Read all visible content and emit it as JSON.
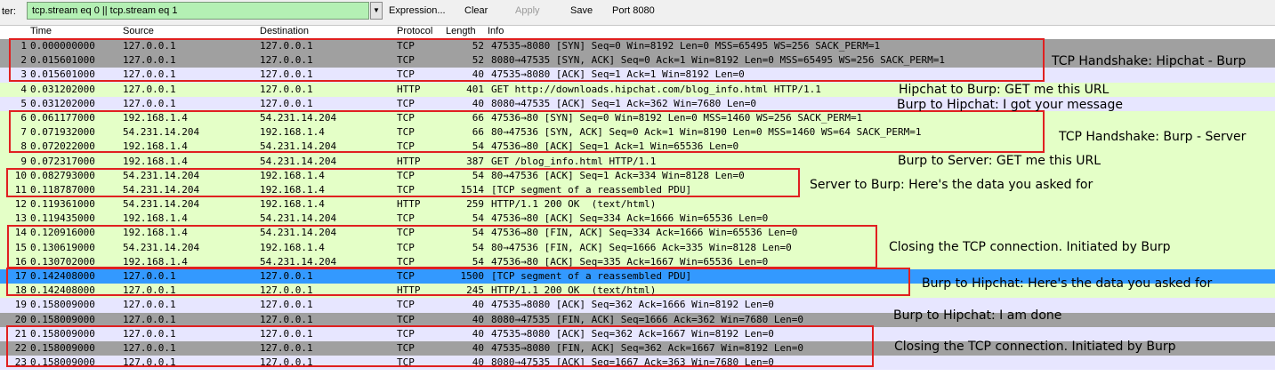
{
  "filter_bar": {
    "label": "ter:",
    "value": "tcp.stream eq 0 || tcp.stream eq 1",
    "dropdown_glyph": "▼",
    "expression_label": "Expression...",
    "clear_label": "Clear",
    "apply_label": "Apply",
    "save_label": "Save",
    "port_label": "Port 8080"
  },
  "columns": [
    "Time",
    "Source",
    "Destination",
    "Protocol",
    "Length",
    "Info"
  ],
  "colors": {
    "tcp_syn_fin": "#a0a0a0",
    "tcp_normal": "#e7e6ff",
    "http": "#e4ffc7",
    "selected": "#3399ff"
  },
  "packets": [
    {
      "no": "1",
      "time": "0.000000000",
      "src": "127.0.0.1",
      "dst": "127.0.0.1",
      "proto": "TCP",
      "len": "52",
      "info": "47535→8080 [SYN] Seq=0 Win=8192 Len=0 MSS=65495 WS=256 SACK_PERM=1",
      "color": "#a0a0a0",
      "fg": "#000000"
    },
    {
      "no": "2",
      "time": "0.015601000",
      "src": "127.0.0.1",
      "dst": "127.0.0.1",
      "proto": "TCP",
      "len": "52",
      "info": "8080→47535 [SYN, ACK] Seq=0 Ack=1 Win=8192 Len=0 MSS=65495 WS=256 SACK_PERM=1",
      "color": "#a0a0a0",
      "fg": "#000000"
    },
    {
      "no": "3",
      "time": "0.015601000",
      "src": "127.0.0.1",
      "dst": "127.0.0.1",
      "proto": "TCP",
      "len": "40",
      "info": "47535→8080 [ACK] Seq=1 Ack=1 Win=8192 Len=0",
      "color": "#e7e6ff",
      "fg": "#000000"
    },
    {
      "no": "4",
      "time": "0.031202000",
      "src": "127.0.0.1",
      "dst": "127.0.0.1",
      "proto": "HTTP",
      "len": "401",
      "info": "GET http://downloads.hipchat.com/blog_info.html HTTP/1.1",
      "color": "#e4ffc7",
      "fg": "#000000"
    },
    {
      "no": "5",
      "time": "0.031202000",
      "src": "127.0.0.1",
      "dst": "127.0.0.1",
      "proto": "TCP",
      "len": "40",
      "info": "8080→47535 [ACK] Seq=1 Ack=362 Win=7680 Len=0",
      "color": "#e7e6ff",
      "fg": "#000000"
    },
    {
      "no": "6",
      "time": "0.061177000",
      "src": "192.168.1.4",
      "dst": "54.231.14.204",
      "proto": "TCP",
      "len": "66",
      "info": "47536→80 [SYN] Seq=0 Win=8192 Len=0 MSS=1460 WS=256 SACK_PERM=1",
      "color": "#e4ffc7",
      "fg": "#000000"
    },
    {
      "no": "7",
      "time": "0.071932000",
      "src": "54.231.14.204",
      "dst": "192.168.1.4",
      "proto": "TCP",
      "len": "66",
      "info": "80→47536 [SYN, ACK] Seq=0 Ack=1 Win=8190 Len=0 MSS=1460 WS=64 SACK_PERM=1",
      "color": "#e4ffc7",
      "fg": "#000000"
    },
    {
      "no": "8",
      "time": "0.072022000",
      "src": "192.168.1.4",
      "dst": "54.231.14.204",
      "proto": "TCP",
      "len": "54",
      "info": "47536→80 [ACK] Seq=1 Ack=1 Win=65536 Len=0",
      "color": "#e4ffc7",
      "fg": "#000000"
    },
    {
      "no": "9",
      "time": "0.072317000",
      "src": "192.168.1.4",
      "dst": "54.231.14.204",
      "proto": "HTTP",
      "len": "387",
      "info": "GET /blog_info.html HTTP/1.1",
      "color": "#e4ffc7",
      "fg": "#000000"
    },
    {
      "no": "10",
      "time": "0.082793000",
      "src": "54.231.14.204",
      "dst": "192.168.1.4",
      "proto": "TCP",
      "len": "54",
      "info": "80→47536 [ACK] Seq=1 Ack=334 Win=8128 Len=0",
      "color": "#e4ffc7",
      "fg": "#000000"
    },
    {
      "no": "11",
      "time": "0.118787000",
      "src": "54.231.14.204",
      "dst": "192.168.1.4",
      "proto": "TCP",
      "len": "1514",
      "info": "[TCP segment of a reassembled PDU]",
      "color": "#e4ffc7",
      "fg": "#000000"
    },
    {
      "no": "12",
      "time": "0.119361000",
      "src": "54.231.14.204",
      "dst": "192.168.1.4",
      "proto": "HTTP",
      "len": "259",
      "info": "HTTP/1.1 200 OK  (text/html)",
      "color": "#e4ffc7",
      "fg": "#000000"
    },
    {
      "no": "13",
      "time": "0.119435000",
      "src": "192.168.1.4",
      "dst": "54.231.14.204",
      "proto": "TCP",
      "len": "54",
      "info": "47536→80 [ACK] Seq=334 Ack=1666 Win=65536 Len=0",
      "color": "#e4ffc7",
      "fg": "#000000"
    },
    {
      "no": "14",
      "time": "0.120916000",
      "src": "192.168.1.4",
      "dst": "54.231.14.204",
      "proto": "TCP",
      "len": "54",
      "info": "47536→80 [FIN, ACK] Seq=334 Ack=1666 Win=65536 Len=0",
      "color": "#e4ffc7",
      "fg": "#000000"
    },
    {
      "no": "15",
      "time": "0.130619000",
      "src": "54.231.14.204",
      "dst": "192.168.1.4",
      "proto": "TCP",
      "len": "54",
      "info": "80→47536 [FIN, ACK] Seq=1666 Ack=335 Win=8128 Len=0",
      "color": "#e4ffc7",
      "fg": "#000000"
    },
    {
      "no": "16",
      "time": "0.130702000",
      "src": "192.168.1.4",
      "dst": "54.231.14.204",
      "proto": "TCP",
      "len": "54",
      "info": "47536→80 [ACK] Seq=335 Ack=1667 Win=65536 Len=0",
      "color": "#e4ffc7",
      "fg": "#000000"
    },
    {
      "no": "17",
      "time": "0.142408000",
      "src": "127.0.0.1",
      "dst": "127.0.0.1",
      "proto": "TCP",
      "len": "1500",
      "info": "[TCP segment of a reassembled PDU]",
      "color": "#3399ff",
      "fg": "#000000"
    },
    {
      "no": "18",
      "time": "0.142408000",
      "src": "127.0.0.1",
      "dst": "127.0.0.1",
      "proto": "HTTP",
      "len": "245",
      "info": "HTTP/1.1 200 OK  (text/html)",
      "color": "#e4ffc7",
      "fg": "#000000"
    },
    {
      "no": "19",
      "time": "0.158009000",
      "src": "127.0.0.1",
      "dst": "127.0.0.1",
      "proto": "TCP",
      "len": "40",
      "info": "47535→8080 [ACK] Seq=362 Ack=1666 Win=8192 Len=0",
      "color": "#e7e6ff",
      "fg": "#000000"
    },
    {
      "no": "20",
      "time": "0.158009000",
      "src": "127.0.0.1",
      "dst": "127.0.0.1",
      "proto": "TCP",
      "len": "40",
      "info": "8080→47535 [FIN, ACK] Seq=1666 Ack=362 Win=7680 Len=0",
      "color": "#a0a0a0",
      "fg": "#000000"
    },
    {
      "no": "21",
      "time": "0.158009000",
      "src": "127.0.0.1",
      "dst": "127.0.0.1",
      "proto": "TCP",
      "len": "40",
      "info": "47535→8080 [ACK] Seq=362 Ack=1667 Win=8192 Len=0",
      "color": "#e7e6ff",
      "fg": "#000000"
    },
    {
      "no": "22",
      "time": "0.158009000",
      "src": "127.0.0.1",
      "dst": "127.0.0.1",
      "proto": "TCP",
      "len": "40",
      "info": "47535→8080 [FIN, ACK] Seq=362 Ack=1667 Win=8192 Len=0",
      "color": "#a0a0a0",
      "fg": "#000000"
    },
    {
      "no": "23",
      "time": "0.158009000",
      "src": "127.0.0.1",
      "dst": "127.0.0.1",
      "proto": "TCP",
      "len": "40",
      "info": "8080→47535 [ACK] Seq=1667 Ack=363 Win=7680 Len=0",
      "color": "#e7e6ff",
      "fg": "#000000"
    }
  ],
  "annotations": [
    "TCP Handshake: Hipchat - Burp",
    "Hipchat to Burp: GET me this URL",
    "Burp to Hipchat: I got your message",
    "TCP Handshake: Burp - Server",
    "Burp to Server: GET me this URL",
    "Server to Burp: Here's the data you asked for",
    "Closing the TCP connection. Initiated by Burp",
    "Burp to Hipchat: Here's the data you asked for",
    "Burp to Hipchat: I am done",
    "Closing the TCP connection. Initiated by Burp"
  ]
}
